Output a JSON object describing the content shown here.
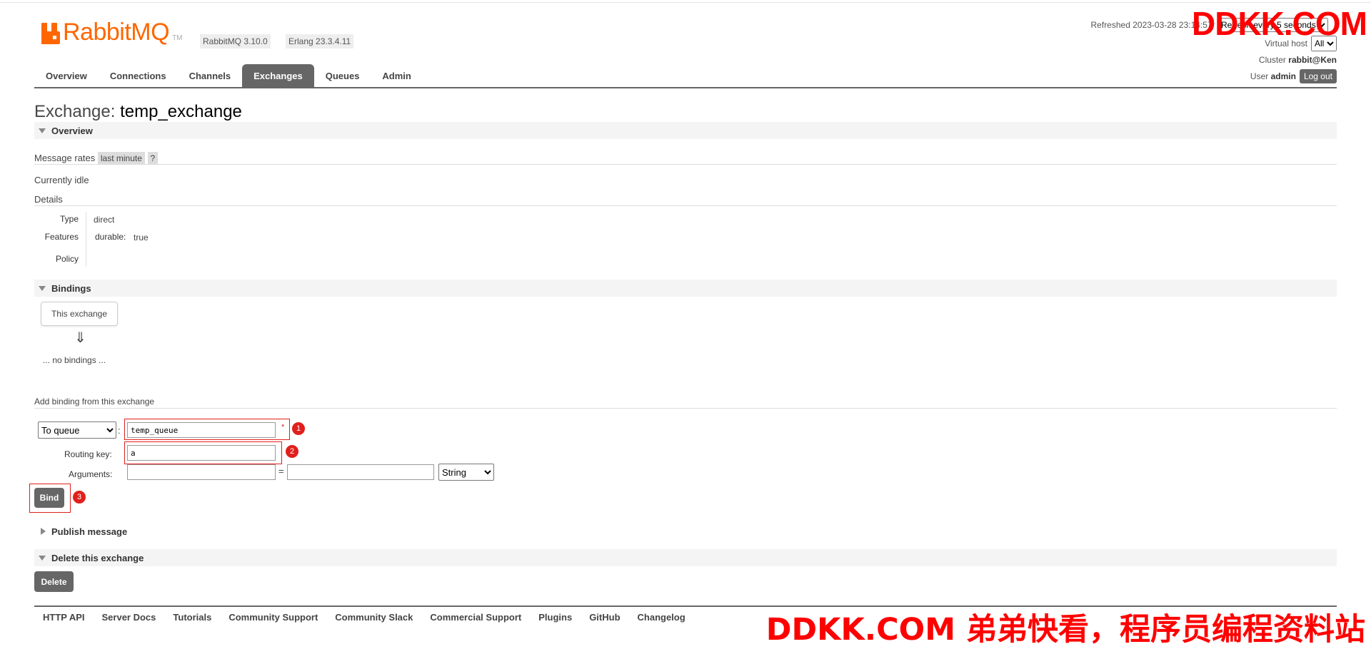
{
  "header": {
    "logo_text": "RabbitMQ",
    "logo_tm": "TM",
    "rabbitmq_version": "RabbitMQ 3.10.0",
    "erlang_version": "Erlang 23.3.4.11",
    "refreshed_text": "Refreshed 2023-03-28 23:14:57",
    "refresh_select": "Refresh every 5 seconds",
    "virtual_host_label": "Virtual host",
    "virtual_host_value": "All",
    "cluster_label": "Cluster",
    "cluster_value": "rabbit@Ken",
    "user_label": "User",
    "user_value": "admin",
    "logout_label": "Log out"
  },
  "tabs": [
    {
      "label": "Overview",
      "active": false
    },
    {
      "label": "Connections",
      "active": false
    },
    {
      "label": "Channels",
      "active": false
    },
    {
      "label": "Exchanges",
      "active": true
    },
    {
      "label": "Queues",
      "active": false
    },
    {
      "label": "Admin",
      "active": false
    }
  ],
  "page": {
    "title_prefix": "Exchange:",
    "title_value": "temp_exchange"
  },
  "overview": {
    "heading": "Overview",
    "message_rates_label": "Message rates",
    "message_rates_range": "last minute",
    "help": "?",
    "idle": "Currently idle",
    "details_label": "Details",
    "type_label": "Type",
    "type_value": "direct",
    "features_label": "Features",
    "features_key": "durable:",
    "features_value": "true",
    "policy_label": "Policy"
  },
  "bindings": {
    "heading": "Bindings",
    "this_exchange": "This exchange",
    "arrow": "⇓",
    "no_bindings": "... no bindings ..."
  },
  "add_binding": {
    "heading": "Add binding from this exchange",
    "destination_type": "To queue",
    "destination_value": "temp_queue",
    "routing_key_label": "Routing key:",
    "routing_key_value": "a",
    "arguments_label": "Arguments:",
    "arg_type": "String",
    "equals": "=",
    "colon": ":",
    "bind_label": "Bind",
    "marker_1": "1",
    "marker_2": "2",
    "marker_3": "3",
    "required_star": "*"
  },
  "publish": {
    "heading": "Publish message"
  },
  "delete": {
    "heading": "Delete this exchange",
    "button": "Delete"
  },
  "footer": [
    "HTTP API",
    "Server Docs",
    "Tutorials",
    "Community Support",
    "Community Slack",
    "Commercial Support",
    "Plugins",
    "GitHub",
    "Changelog"
  ],
  "watermark": {
    "top": "DDKK.COM",
    "bottom": "DDKK.COM 弟弟快看，程序员编程资料站"
  },
  "colors": {
    "logo": "#ff6600",
    "accent_gray": "#666666",
    "annotation_red": "#e0201c"
  }
}
